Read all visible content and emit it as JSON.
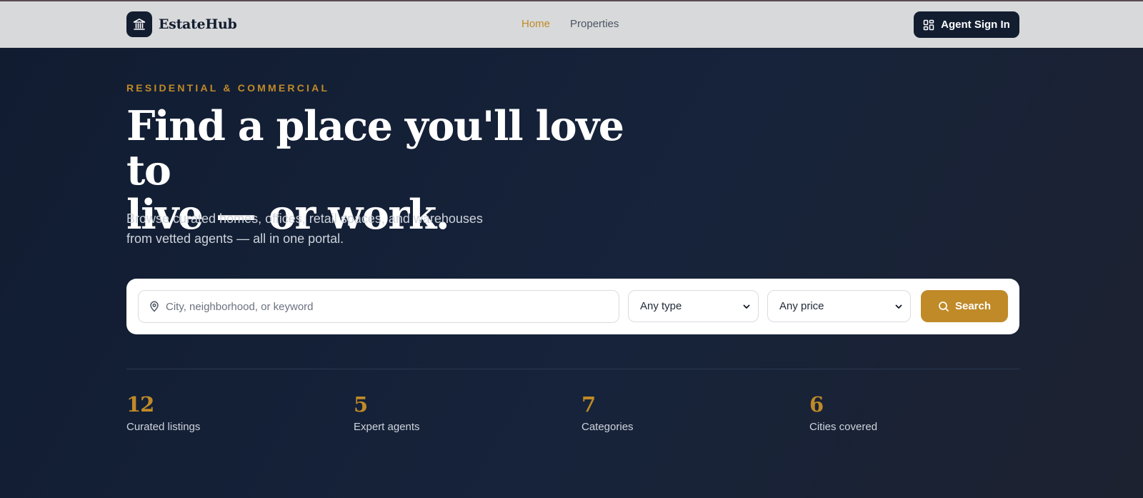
{
  "nav": {
    "brand": "EstateHub",
    "links": [
      {
        "label": "Home",
        "active": true
      },
      {
        "label": "Properties",
        "active": false
      }
    ],
    "signin_label": "Agent Sign In"
  },
  "hero": {
    "eyebrow": "RESIDENTIAL & COMMERCIAL",
    "headline_line1": "Find a place you'll love to",
    "headline_line2": "live — or work.",
    "subtext_line1": "Browse curated homes, offices, retail spaces, and warehouses",
    "subtext_line2": "from vetted agents — all in one portal."
  },
  "search": {
    "placeholder": "City, neighborhood, or keyword",
    "value": "",
    "type_selected": "Any type",
    "price_selected": "Any price",
    "button_label": "Search"
  },
  "stats": [
    {
      "value": "12",
      "label": "Curated listings"
    },
    {
      "value": "5",
      "label": "Expert agents"
    },
    {
      "value": "7",
      "label": "Categories"
    },
    {
      "value": "6",
      "label": "Cities covered"
    }
  ],
  "colors": {
    "accent": "#c08a28",
    "navy": "#131d30",
    "navbar_bg": "#d8d9da"
  },
  "icons": {
    "logo": "bank-building-icon",
    "signin": "dashboard-grid-icon",
    "location": "map-pin-icon",
    "search": "search-icon",
    "chevron": "chevron-down-icon"
  }
}
